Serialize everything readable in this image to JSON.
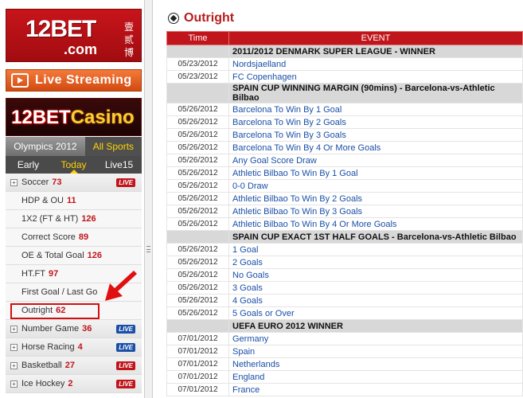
{
  "sidebar": {
    "logo": {
      "brand": "12BET",
      "domain": ".com",
      "chinese": "壹贰博"
    },
    "live_streaming_label": "Live Streaming",
    "casino": {
      "brand": "12BET",
      "suffix": "Casino"
    },
    "tabs_top": [
      "Olympics 2012",
      "All Sports"
    ],
    "tabs_day": [
      "Early",
      "Today",
      "Live15"
    ],
    "menu": {
      "soccer": {
        "label": "Soccer",
        "count": "73",
        "badge": "LIVE"
      },
      "hdp_ou": {
        "label": "HDP & OU",
        "count": "11"
      },
      "x12": {
        "label": "1X2 (FT & HT)",
        "count": "126"
      },
      "correct_score": {
        "label": "Correct Score",
        "count": "89"
      },
      "oe_total": {
        "label": "OE & Total Goal",
        "count": "126"
      },
      "htft": {
        "label": "HT.FT",
        "count": "97"
      },
      "first_last": {
        "label": "First Goal / Last Go"
      },
      "outright": {
        "label": "Outright",
        "count": "62"
      },
      "number_game": {
        "label": "Number Game",
        "count": "36",
        "badge": "LIVE"
      },
      "horse_racing": {
        "label": "Horse Racing",
        "count": "4",
        "badge": "LIVE"
      },
      "basketball": {
        "label": "Basketball",
        "count": "27",
        "badge": "LIVE"
      },
      "ice_hockey": {
        "label": "Ice Hockey",
        "count": "2",
        "badge": "LIVE"
      }
    }
  },
  "main": {
    "title": "Outright",
    "columns": {
      "time": "Time",
      "event": "EVENT"
    },
    "groups": [
      {
        "title": "2011/2012 DENMARK SUPER LEAGUE - WINNER",
        "rows": [
          {
            "date": "05/23/2012",
            "event": "Nordsjaelland"
          },
          {
            "date": "05/23/2012",
            "event": "FC Copenhagen"
          }
        ]
      },
      {
        "title": "SPAIN CUP WINNING MARGIN (90mins) - Barcelona-vs-Athletic Bilbao",
        "rows": [
          {
            "date": "05/26/2012",
            "event": "Barcelona To Win By 1 Goal"
          },
          {
            "date": "05/26/2012",
            "event": "Barcelona To Win By 2 Goals"
          },
          {
            "date": "05/26/2012",
            "event": "Barcelona To Win By 3 Goals"
          },
          {
            "date": "05/26/2012",
            "event": "Barcelona To Win By 4 Or More Goals"
          },
          {
            "date": "05/26/2012",
            "event": "Any Goal Score Draw"
          },
          {
            "date": "05/26/2012",
            "event": "Athletic Bilbao To Win By 1 Goal"
          },
          {
            "date": "05/26/2012",
            "event": "0-0 Draw"
          },
          {
            "date": "05/26/2012",
            "event": "Athletic Bilbao To Win By 2 Goals"
          },
          {
            "date": "05/26/2012",
            "event": "Athletic Bilbao To Win By 3 Goals"
          },
          {
            "date": "05/26/2012",
            "event": "Athletic Bilbao To Win By 4 Or More Goals"
          }
        ]
      },
      {
        "title": "SPAIN CUP EXACT 1ST HALF GOALS - Barcelona-vs-Athletic Bilbao",
        "rows": [
          {
            "date": "05/26/2012",
            "event": "1 Goal"
          },
          {
            "date": "05/26/2012",
            "event": "2 Goals"
          },
          {
            "date": "05/26/2012",
            "event": "No Goals"
          },
          {
            "date": "05/26/2012",
            "event": "3 Goals"
          },
          {
            "date": "05/26/2012",
            "event": "4 Goals"
          },
          {
            "date": "05/26/2012",
            "event": "5 Goals or Over"
          }
        ]
      },
      {
        "title": "UEFA EURO 2012 WINNER",
        "rows": [
          {
            "date": "07/01/2012",
            "event": "Germany"
          },
          {
            "date": "07/01/2012",
            "event": "Spain"
          },
          {
            "date": "07/01/2012",
            "event": "Netherlands"
          },
          {
            "date": "07/01/2012",
            "event": "England"
          },
          {
            "date": "07/01/2012",
            "event": "France"
          }
        ]
      }
    ]
  },
  "colors": {
    "brand_red": "#c0151b",
    "link_blue": "#1a4fa8",
    "highlight_yellow": "#ffd200"
  }
}
